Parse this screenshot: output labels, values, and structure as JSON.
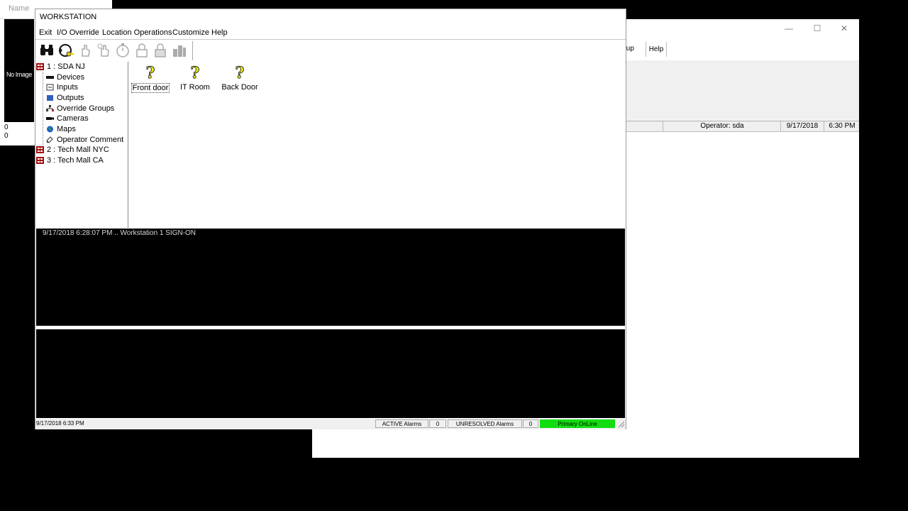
{
  "bg_left": {
    "header": "Name",
    "image_text": "No Image",
    "num1": "0",
    "num2": "0"
  },
  "bg_right": {
    "min": "—",
    "max": "☐",
    "close": "✕",
    "menu_partial": "tup",
    "menu_help": "Help",
    "operator": "Operator:  sda",
    "date": "9/17/2018",
    "time": "6:30 PM"
  },
  "window": {
    "title": "WORKSTATION"
  },
  "menu": [
    "Exit",
    "I/O Override",
    "Location Operations",
    "Customize",
    "Help"
  ],
  "tree": {
    "loc1": "1 :  SDA  NJ",
    "children": [
      "Devices",
      "Inputs",
      "Outputs",
      "Override Groups",
      "Cameras",
      "Maps",
      "Operator Comment"
    ],
    "loc2": "2 :  Tech Mall NYC",
    "loc3": "3 :  Tech Mall CA"
  },
  "doors": [
    {
      "glyph": "?",
      "label": "Front door"
    },
    {
      "glyph": "?",
      "label": "IT Room"
    },
    {
      "glyph": "?",
      "label": "Back Door"
    }
  ],
  "log": {
    "line1": "9/17/2018 6:28:07 PM .. Workstation 1 SIGN-ON"
  },
  "status": {
    "datetime": "9/17/2018 6:33 PM",
    "active_label": "ACTIVE Alarms",
    "active_count": "0",
    "unresolved_label": "UNRESOLVED Alarms",
    "unresolved_count": "0",
    "online": "Primary OnLine",
    "online_color": "#11dd11"
  }
}
